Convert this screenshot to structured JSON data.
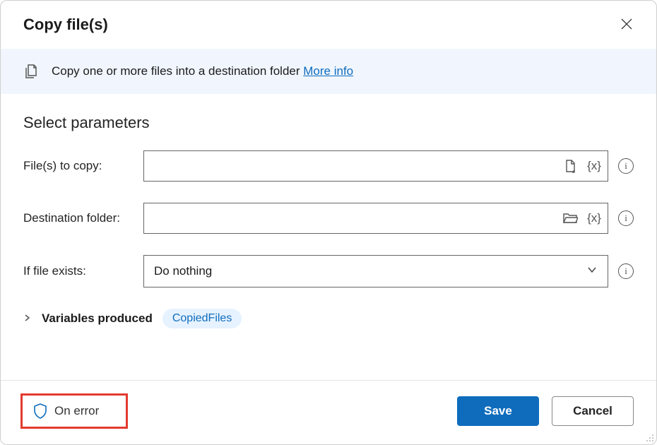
{
  "dialog": {
    "title": "Copy file(s)",
    "info_text": "Copy one or more files into a destination folder ",
    "more_info": "More info"
  },
  "section_title": "Select parameters",
  "fields": {
    "files_to_copy": {
      "label": "File(s) to copy:",
      "value": ""
    },
    "destination_folder": {
      "label": "Destination folder:",
      "value": ""
    },
    "if_file_exists": {
      "label": "If file exists:",
      "selected": "Do nothing"
    }
  },
  "variables": {
    "label": "Variables produced",
    "items": [
      "CopiedFiles"
    ]
  },
  "footer": {
    "on_error": "On error",
    "save": "Save",
    "cancel": "Cancel"
  },
  "icons": {
    "var_token": "{x}"
  }
}
